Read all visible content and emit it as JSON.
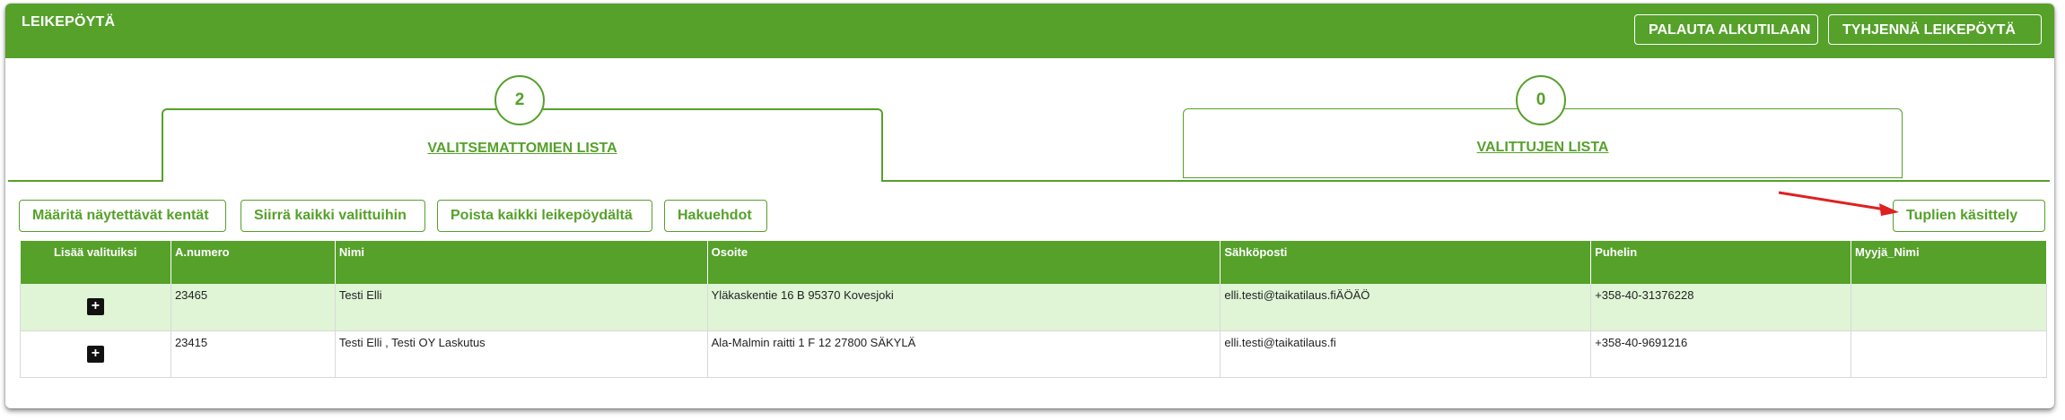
{
  "header": {
    "title": "LEIKEPÖYTÄ",
    "reset_label": "PALAUTA ALKUTILAAN",
    "empty_label": "TYHJENNÄ LEIKEPÖYTÄ"
  },
  "tabs": [
    {
      "count": "2",
      "label": "VALITSEMATTOMIEN LISTA",
      "active": true
    },
    {
      "count": "0",
      "label": "VALITTUJEN LISTA",
      "active": false
    }
  ],
  "actions": {
    "define_fields": "Määritä näytettävät kentät",
    "move_all": "Siirrä kaikki valittuihin",
    "remove_all": "Poista kaikki leikepöydältä",
    "search_criteria": "Hakuehdot",
    "duplicates": "Tuplien käsittely"
  },
  "table": {
    "headers": [
      "Lisää valituiksi",
      "A.numero",
      "Nimi",
      "Osoite",
      "Sähköposti",
      "Puhelin",
      "Myyjä_Nimi"
    ],
    "rows": [
      {
        "add": "+",
        "number": "23465",
        "name": "Testi Elli",
        "address": "Yläkaskentie 16 B 95370 Kovesjoki",
        "email": "elli.testi@taikatilaus.fiÄÖÄÖ",
        "phone": "+358-40-31376228",
        "seller": ""
      },
      {
        "add": "+",
        "number": "23415",
        "name": "Testi Elli , Testi OY Laskutus",
        "address": "Ala-Malmin raitti 1 F 12 27800 SÄKYLÄ",
        "email": "elli.testi@taikatilaus.fi",
        "phone": "+358-40-9691216",
        "seller": ""
      }
    ]
  },
  "colors": {
    "accent": "#55a12a",
    "row_highlight": "#dff5d6",
    "arrow": "#e02020"
  }
}
